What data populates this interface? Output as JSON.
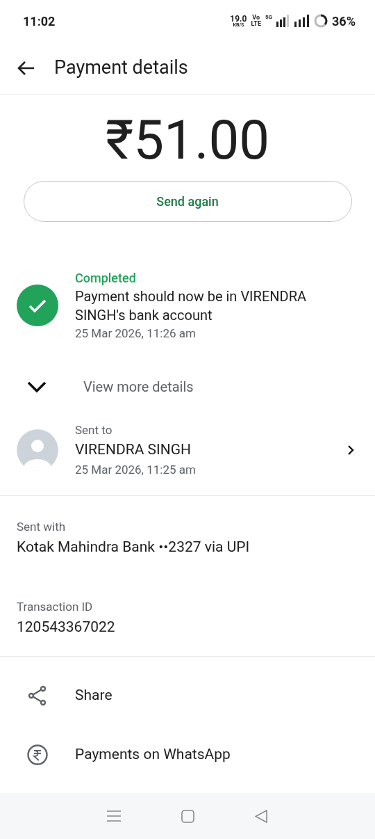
{
  "status_bar": {
    "time": "11:02",
    "speed_value": "19.0",
    "speed_unit": "KB/S",
    "volte_top": "Vo",
    "volte_bottom": "LTE",
    "network": "5G",
    "battery": "36%"
  },
  "header": {
    "title": "Payment details"
  },
  "amount": "₹51.00",
  "send_again": "Send again",
  "status": {
    "kind": "completed",
    "label": "Completed",
    "message": "Payment should now be in VIRENDRA SINGH's bank account",
    "time": "25 Mar 2026, 11:26 am"
  },
  "view_more": {
    "label": "View more details",
    "expanded": false
  },
  "recipient": {
    "caption": "Sent to",
    "name": "VIRENDRA SINGH",
    "time": "25 Mar 2026, 11:25 am"
  },
  "sent_with": {
    "caption": "Sent with",
    "value": "Kotak Mahindra Bank ••2327 via UPI"
  },
  "transaction": {
    "caption": "Transaction ID",
    "value": "120543367022"
  },
  "actions": [
    {
      "kind": "share",
      "label": "Share"
    },
    {
      "kind": "rupee",
      "label": "Payments on WhatsApp"
    }
  ]
}
